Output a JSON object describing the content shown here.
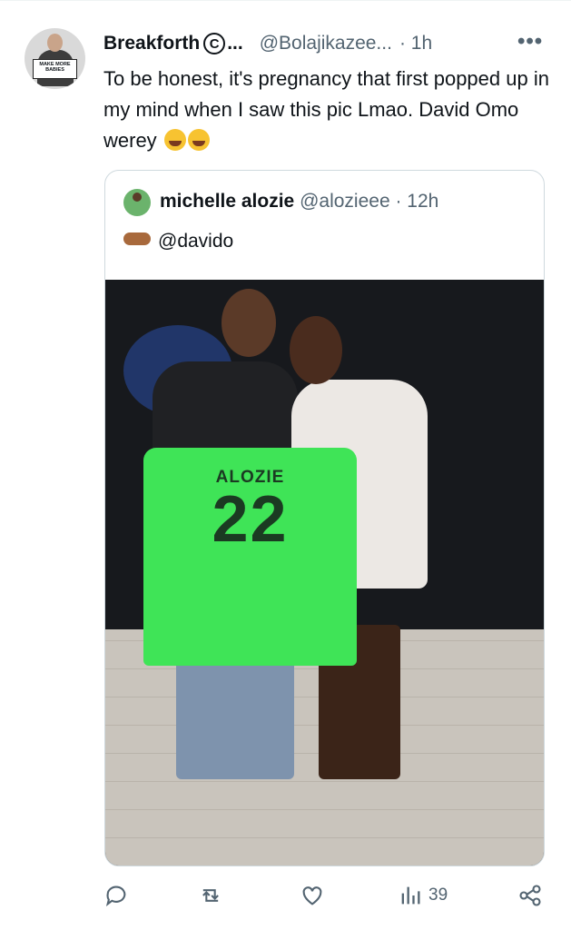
{
  "tweet": {
    "author_name": "Breakforth",
    "author_badge": "C",
    "author_ellipsis": "...",
    "author_handle": "@Bolajikazee...",
    "time": "· 1h",
    "text": "To be honest, it's pregnancy that first popped up in my mind when I saw this pic Lmao. David Omo werey",
    "avatar_sign": "MAKE MORE BABIES",
    "more_label": "•••"
  },
  "quote": {
    "author_name": "michelle alozie",
    "author_handle": "@alozieee",
    "time": "· 12h",
    "text": "@davido",
    "jersey_name": "ALOZIE",
    "jersey_number": "22"
  },
  "actions": {
    "views_count": "39"
  },
  "icons": [
    "reply-icon",
    "retweet-icon",
    "like-icon",
    "views-icon",
    "share-icon"
  ],
  "colors": {
    "text": "#0f1419",
    "secondary": "#536471",
    "border": "#cfd9de",
    "jersey": "#3fe457"
  }
}
